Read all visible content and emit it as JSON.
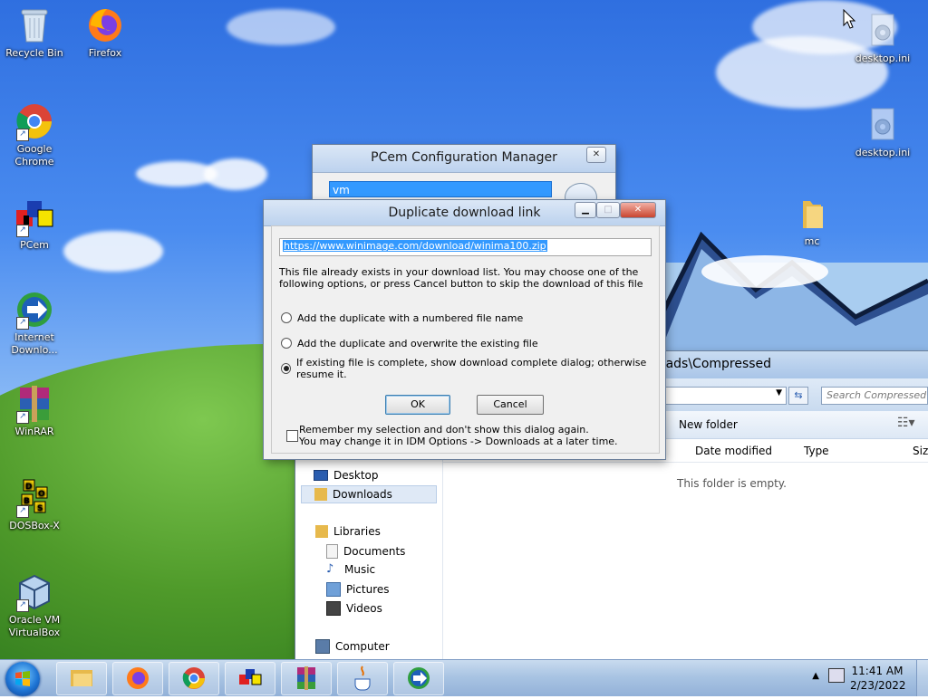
{
  "desktop": {
    "icons": [
      {
        "label": "Recycle Bin"
      },
      {
        "label": "Firefox"
      },
      {
        "label": "Google Chrome"
      },
      {
        "label": "PCem"
      },
      {
        "label": "Internet Downlo..."
      },
      {
        "label": "WinRAR"
      },
      {
        "label": "DOSBox-X"
      },
      {
        "label": "Oracle VM VirtualBox"
      },
      {
        "label": "desktop.ini"
      },
      {
        "label": "desktop.ini"
      },
      {
        "label": "mc"
      }
    ]
  },
  "pcem_window": {
    "title": "PCem Configuration Manager",
    "selected_item": "vm"
  },
  "dialog": {
    "title": "Duplicate download link",
    "url": "https://www.winimage.com/download/winima100.zip",
    "message": "This file already exists in your download list. You may choose one of the following options, or press Cancel button to skip the download of this file",
    "options": [
      {
        "label": "Add the duplicate with a numbered file name",
        "selected": false
      },
      {
        "label": "Add the duplicate and overwrite the existing file",
        "selected": false
      },
      {
        "label": "If existing file is complete, show download complete dialog; otherwise resume it.",
        "selected": true
      }
    ],
    "ok_label": "OK",
    "cancel_label": "Cancel",
    "remember_label_1": "Remember my selection and don't show this dialog again.",
    "remember_label_2": "You may change it in IDM Options -> Downloads at a later time."
  },
  "explorer": {
    "title_fragment": "oads\\Compressed",
    "search_placeholder": "Search Compressed",
    "new_folder": "New folder",
    "col_date": "Date modified",
    "col_type": "Type",
    "col_size": "Size",
    "empty_text": "This folder is empty.",
    "nav": {
      "desktop": "Desktop",
      "downloads": "Downloads",
      "libraries": "Libraries",
      "documents": "Documents",
      "music": "Music",
      "pictures": "Pictures",
      "videos": "Videos",
      "computer": "Computer"
    }
  },
  "taskbar": {
    "time": "11:41 AM",
    "date": "2/23/2022"
  },
  "colors": {
    "accent": "#3399ff",
    "selection": "#3399ff"
  }
}
